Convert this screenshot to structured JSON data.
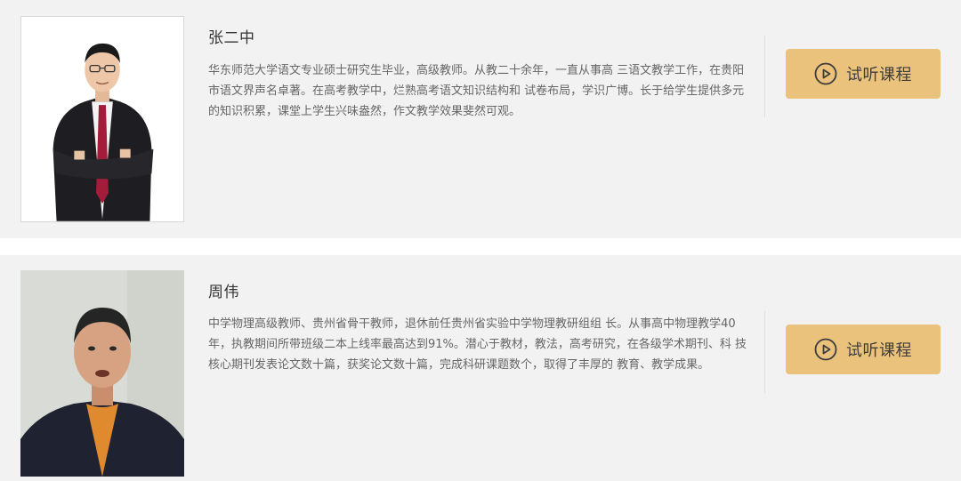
{
  "teachers": [
    {
      "name": "张二中",
      "description": "华东师范大学语文专业硕士研究生毕业，高级教师。从教二十余年，一直从事高 三语文教学工作，在贵阳市语文界声名卓著。在高考教学中，烂熟高考语文知识结构和 试卷布局，学识广博。长于给学生提供多元的知识积累，课堂上学生兴味盎然，作文教学效果斐然可观。",
      "button_label": "试听课程",
      "button_icon": "play-circle-icon"
    },
    {
      "name": "周伟",
      "description": "中学物理高级教师、贵州省骨干教师，退休前任贵州省实验中学物理教研组组 长。从事高中物理教学40年，执教期间所带班级二本上线率最高达到91%。潜心于教材，教法，高考研究，在各级学术期刊、科 技核心期刊发表论文数十篇，获奖论文数十篇，完成科研课题数个，取得了丰厚的 教育、教学成果。",
      "button_label": "试听课程",
      "button_icon": "play-circle-icon"
    }
  ],
  "colors": {
    "card_background": "#f2f2f2",
    "button_background": "#ebc27c",
    "name_text": "#333333",
    "description_text": "#666666"
  }
}
